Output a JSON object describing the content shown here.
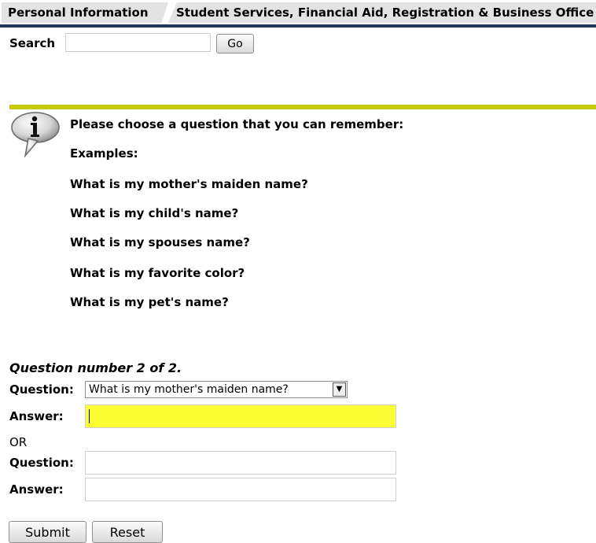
{
  "tabs": [
    {
      "label": "Personal Information"
    },
    {
      "label": "Student Services, Financial Aid, Registration & Business Office"
    }
  ],
  "search": {
    "label": "Search",
    "value": "",
    "button_label": "Go"
  },
  "info": {
    "icon": "info-speech-bubble-icon",
    "prompt": "Please choose a question that you can remember:",
    "examples_label": "Examples:",
    "examples": [
      "What is my mother's maiden name?",
      "What is my child's name?",
      "What is my spouses name?",
      "What is my favorite color?",
      "What is my pet's name?"
    ]
  },
  "form": {
    "heading": "Question number 2 of 2.",
    "question_label": "Question:",
    "selected_question": "What is my mother's maiden name?",
    "answer_label": "Answer:",
    "answer_value": "",
    "or_label": "OR",
    "custom_question_label": "Question:",
    "custom_question_value": "",
    "custom_answer_label": "Answer:",
    "custom_answer_value": "",
    "submit_label": "Submit",
    "reset_label": "Reset"
  },
  "colors": {
    "tab_bg": "#e3e3e3",
    "tab_underline": "#233a5e",
    "rule": "#c8c800",
    "answer_highlight": "#fbff33"
  }
}
